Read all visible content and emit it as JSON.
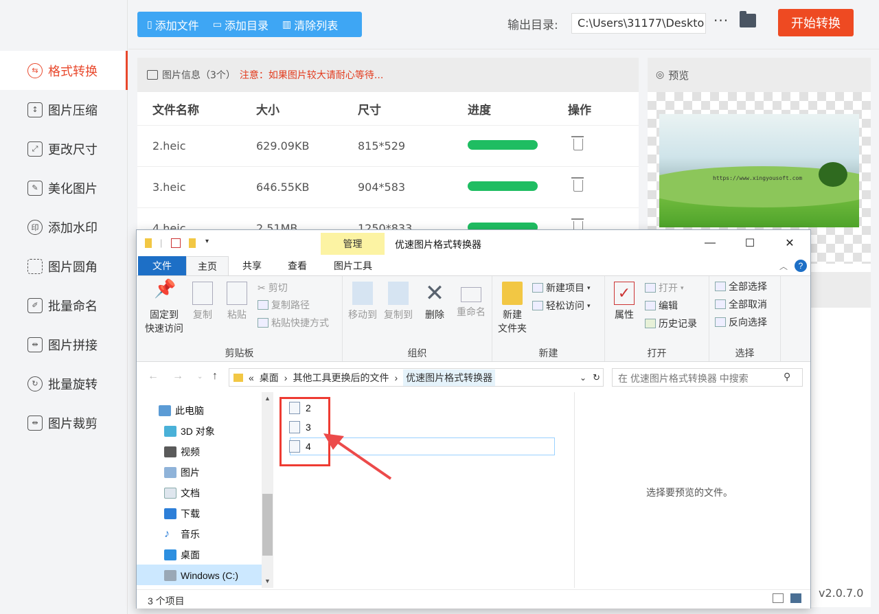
{
  "sidebar": {
    "items": [
      {
        "label": "格式转换",
        "icon": "format-convert-icon",
        "active": true
      },
      {
        "label": "图片压缩",
        "icon": "compress-icon"
      },
      {
        "label": "更改尺寸",
        "icon": "resize-icon"
      },
      {
        "label": "美化图片",
        "icon": "beautify-icon"
      },
      {
        "label": "添加水印",
        "icon": "watermark-icon"
      },
      {
        "label": "图片圆角",
        "icon": "round-corner-icon"
      },
      {
        "label": "批量命名",
        "icon": "rename-icon"
      },
      {
        "label": "图片拼接",
        "icon": "stitch-icon"
      },
      {
        "label": "批量旋转",
        "icon": "rotate-icon"
      },
      {
        "label": "图片裁剪",
        "icon": "crop-icon"
      }
    ]
  },
  "toolbar": {
    "add_file": "添加文件",
    "add_dir": "添加目录",
    "clear_list": "清除列表",
    "output_label": "输出目录:",
    "output_path": "C:\\Users\\31177\\Deskto",
    "more": "···",
    "start": "开始转换"
  },
  "info": {
    "title": "图片信息（3个）",
    "note": "注意：如果图片较大请耐心等待...",
    "columns": [
      "文件名称",
      "大小",
      "尺寸",
      "进度",
      "操作"
    ],
    "rows": [
      {
        "name": "2.heic",
        "size": "629.09KB",
        "dims": "815*529",
        "progress": 1.0
      },
      {
        "name": "3.heic",
        "size": "646.55KB",
        "dims": "904*583",
        "progress": 1.0
      },
      {
        "name": "4.heic",
        "size": "2.51MB",
        "dims": "1250*833",
        "progress": 1.0
      }
    ]
  },
  "preview": {
    "title": "预览",
    "watermark": "https://www.xingyousoft.com"
  },
  "version": "v2.0.7.0",
  "explorer": {
    "manage_tab": "管理",
    "title": "优速图片格式转换器",
    "tabs": {
      "file": "文件",
      "home": "主页",
      "share": "共享",
      "view": "查看",
      "picture_tools": "图片工具"
    },
    "clipboard": {
      "group": "剪贴板",
      "pin": "固定到\n快速访问",
      "copy": "复制",
      "paste": "粘贴",
      "cut": "剪切",
      "copy_path": "复制路径",
      "paste_shortcut": "粘贴快捷方式"
    },
    "organize": {
      "group": "组织",
      "move_to": "移动到",
      "copy_to": "复制到",
      "delete": "删除",
      "rename": "重命名"
    },
    "new": {
      "group": "新建",
      "new_folder": "新建\n文件夹",
      "new_item": "新建项目",
      "easy_access": "轻松访问"
    },
    "open": {
      "group": "打开",
      "properties": "属性",
      "open": "打开",
      "edit": "编辑",
      "history": "历史记录"
    },
    "select": {
      "group": "选择",
      "select_all": "全部选择",
      "select_none": "全部取消",
      "invert": "反向选择"
    },
    "breadcrumb": [
      "«",
      "桌面",
      "其他工具更换后的文件",
      "优速图片格式转换器"
    ],
    "search_placeholder": "在 优速图片格式转换器 中搜索",
    "nav": [
      "此电脑",
      "3D 对象",
      "视频",
      "图片",
      "文档",
      "下载",
      "音乐",
      "桌面",
      "Windows (C:)"
    ],
    "files": [
      "2",
      "3",
      "4"
    ],
    "preview_text": "选择要预览的文件。",
    "status": "3 个项目"
  }
}
